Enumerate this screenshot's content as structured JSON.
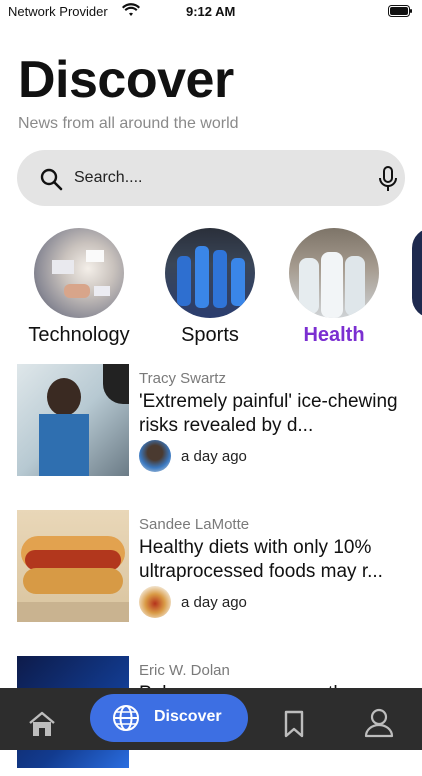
{
  "status_bar": {
    "carrier": "Network Provider",
    "time": "9:12 AM"
  },
  "header": {
    "title": "Discover",
    "subtitle": "News from all around the world"
  },
  "search": {
    "placeholder": "Search...."
  },
  "categories": [
    {
      "label": "Technology",
      "active": false
    },
    {
      "label": "Sports",
      "active": false
    },
    {
      "label": "Health",
      "active": true
    }
  ],
  "articles": [
    {
      "author": "Tracy Swartz",
      "title": "'Extremely painful' ice-chewing risks revealed by d...",
      "time": "a day ago"
    },
    {
      "author": "Sandee LaMotte",
      "title": "Healthy diets with only 10% ultraprocessed foods may r...",
      "time": "a day ago"
    },
    {
      "author": "Eric W. Dolan",
      "title": "Polyamory among youth:",
      "time": ""
    }
  ],
  "tabbar": {
    "discover_label": "Discover"
  },
  "colors": {
    "accent": "#3d6fe3",
    "active_category": "#7b2fd1",
    "tabbar_bg": "#2d2d2d"
  }
}
